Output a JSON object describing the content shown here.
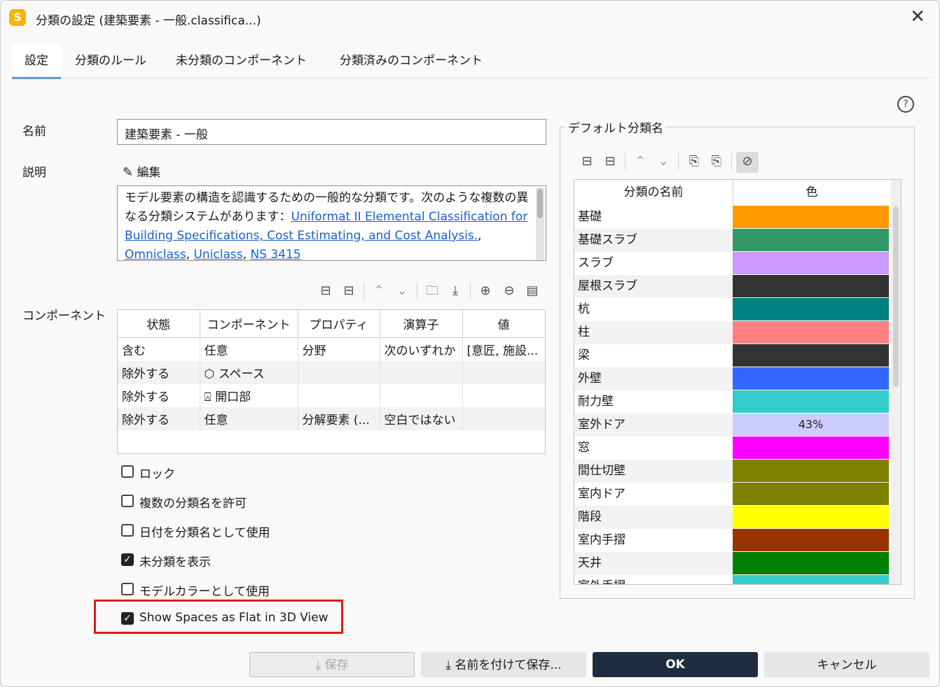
{
  "window": {
    "title": "分類の設定 (建築要素 - 一般.classifica...)",
    "app_icon_letter": "S"
  },
  "tabs": [
    {
      "label": "設定",
      "active": true
    },
    {
      "label": "分類のルール",
      "active": false
    },
    {
      "label": "未分類のコンポーネント",
      "active": false
    },
    {
      "label": "分類済みのコンポーネント",
      "active": false
    }
  ],
  "form": {
    "name_label": "名前",
    "name_value": "建築要素 - 一般",
    "desc_label": "説明",
    "edit_label": "編集",
    "desc_text": "モデル要素の構造を認識するための一般的な分類です。次のような複数の異なる分類システムがあります：",
    "desc_links": [
      "Uniformat II Elemental Classification for Building Specifications, Cost Estimating, and Cost Analysis.",
      "Omniclass",
      "Uniclass",
      "NS 3415"
    ],
    "components_label": "コンポーネント"
  },
  "rules_table": {
    "headers": [
      "状態",
      "コンポーネント",
      "プロパティ",
      "演算子",
      "値"
    ],
    "rows": [
      {
        "state": "含む",
        "component": "任意",
        "component_icon": "",
        "property": "分野",
        "operator": "次のいずれか",
        "value": "[意匠, 施設..."
      },
      {
        "state": "除外する",
        "component": "スペース",
        "component_icon": "cube-icon",
        "property": "",
        "operator": "",
        "value": ""
      },
      {
        "state": "除外する",
        "component": "開口部",
        "component_icon": "door-icon",
        "property": "",
        "operator": "",
        "value": ""
      },
      {
        "state": "除外する",
        "component": "任意",
        "component_icon": "",
        "property": "分解要素 (...",
        "operator": "空白ではない",
        "value": ""
      }
    ]
  },
  "options": [
    {
      "label": "ロック",
      "checked": false
    },
    {
      "label": "複数の分類名を許可",
      "checked": false
    },
    {
      "label": "日付を分類名として使用",
      "checked": false
    },
    {
      "label": "未分類を表示",
      "checked": true
    },
    {
      "label": "モデルカラーとして使用",
      "checked": false
    },
    {
      "label": "Show Spaces as Flat in 3D View",
      "checked": true
    }
  ],
  "default_class": {
    "legend": "デフォルト分類名",
    "col_name": "分類の名前",
    "col_color": "色",
    "rows": [
      {
        "name": "基礎",
        "color": "#ff9900",
        "text": ""
      },
      {
        "name": "基礎スラブ",
        "color": "#339966",
        "text": ""
      },
      {
        "name": "スラブ",
        "color": "#cc99ff",
        "text": ""
      },
      {
        "name": "屋根スラブ",
        "color": "#333333",
        "text": ""
      },
      {
        "name": "杭",
        "color": "#008080",
        "text": ""
      },
      {
        "name": "柱",
        "color": "#ff8080",
        "text": ""
      },
      {
        "name": "梁",
        "color": "#333333",
        "text": ""
      },
      {
        "name": "外壁",
        "color": "#3366ff",
        "text": ""
      },
      {
        "name": "耐力壁",
        "color": "#33cccc",
        "text": ""
      },
      {
        "name": "室外ドア",
        "color": "#ccccff",
        "text": "43%"
      },
      {
        "name": "窓",
        "color": "#ff00ff",
        "text": ""
      },
      {
        "name": "間仕切壁",
        "color": "#808000",
        "text": ""
      },
      {
        "name": "室内ドア",
        "color": "#808000",
        "text": ""
      },
      {
        "name": "階段",
        "color": "#ffff00",
        "text": ""
      },
      {
        "name": "室内手摺",
        "color": "#993300",
        "text": ""
      },
      {
        "name": "天井",
        "color": "#008000",
        "text": ""
      },
      {
        "name": "室外手摺",
        "color": "#33cccc",
        "text": ""
      }
    ]
  },
  "buttons": {
    "save": "保存",
    "save_as": "名前を付けて保存...",
    "ok": "OK",
    "cancel": "キャンセル"
  },
  "colors": {
    "accent": "#1d72c7",
    "ok_button": "#1f2d40",
    "highlight_box": "#e01b1b",
    "link": "#1a5fd0"
  }
}
